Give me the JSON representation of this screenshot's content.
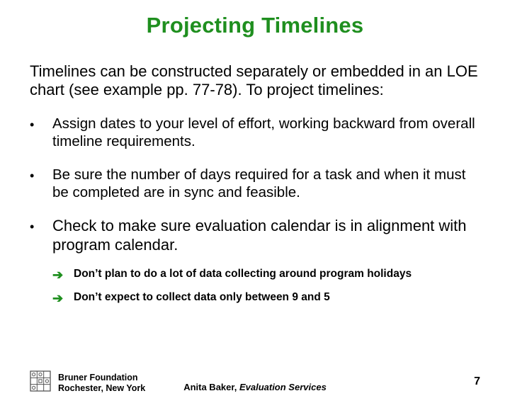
{
  "title": "Projecting Timelines",
  "intro": "Timelines can be constructed separately or embedded in an LOE chart (see example pp. 77-78). To project timelines:",
  "bullets": {
    "b1": "Assign dates to your level of effort, working backward from overall timeline requirements.",
    "b2": "Be sure the number of days required for a task and when it must be completed are in sync and feasible.",
    "b3": "Check to make sure evaluation calendar is in alignment with program calendar."
  },
  "sub_bullets": {
    "s1": "Don’t plan to do a lot of data collecting around program holidays",
    "s2": "Don’t expect to collect data only between 9 and 5"
  },
  "footer": {
    "org_line1": "Bruner Foundation",
    "org_line2": "Rochester, New York",
    "credit_name": "Anita Baker, ",
    "credit_ital": "Evaluation Services",
    "page": "7"
  }
}
